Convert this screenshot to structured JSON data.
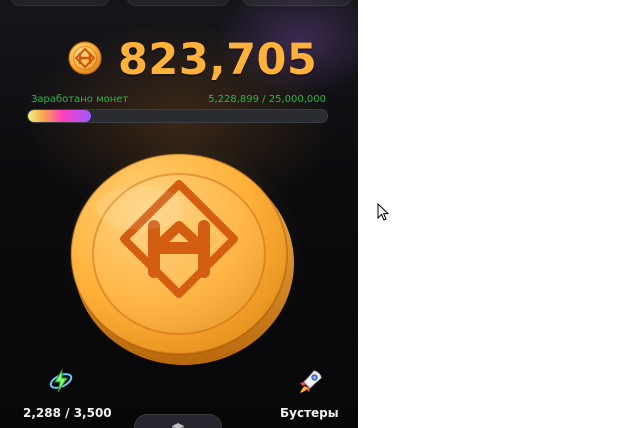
{
  "balance": {
    "value": "823,705"
  },
  "earned": {
    "label": "Заработано монет",
    "progress_text": "5,228,899 / 25,000,000",
    "progress_fraction": 0.2091559
  },
  "energy": {
    "text": "2,288 / 3,500",
    "icon": "lightning-orbit-icon"
  },
  "boosters": {
    "label": "Бустеры",
    "icon": "rocket-icon"
  },
  "colors": {
    "accent": "#ffb13a",
    "earned_text": "#2db54a",
    "progress_track": "#2a2c31"
  },
  "icons": {
    "balance_coin": "coin-icon",
    "main_coin": "tap-coin",
    "cursor": "mouse-pointer-icon"
  }
}
